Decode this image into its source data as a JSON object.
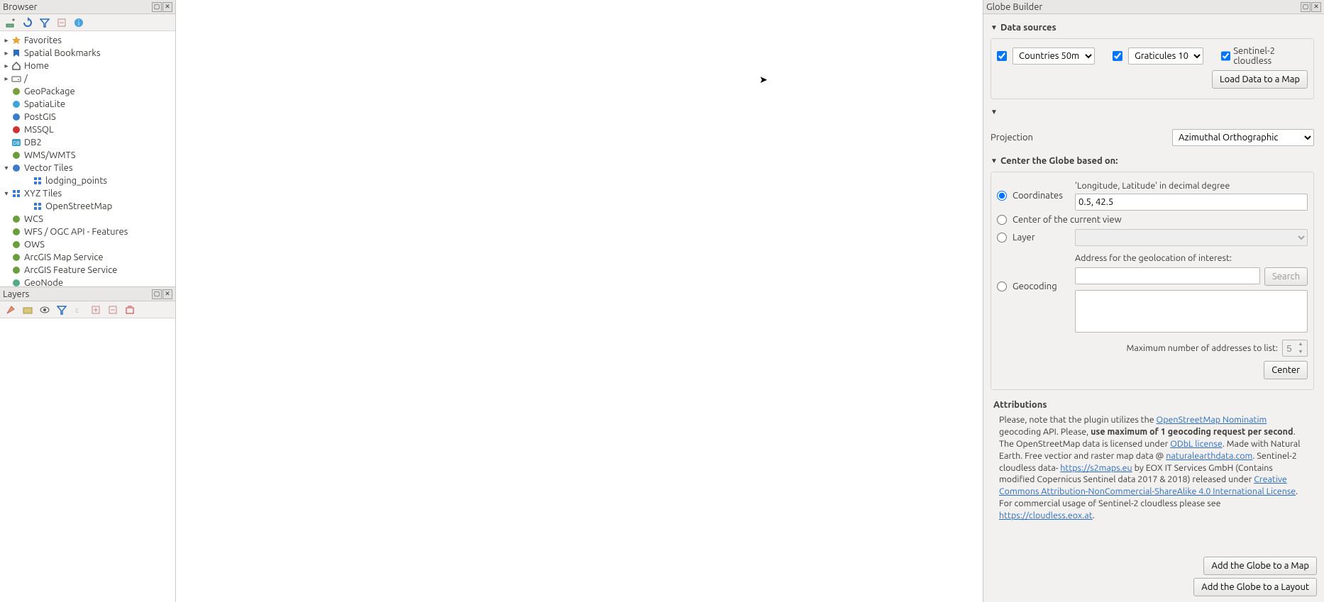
{
  "browser": {
    "title": "Browser",
    "items": [
      {
        "label": "Favorites",
        "caret": "▸",
        "indent": 0,
        "icon": "star"
      },
      {
        "label": "Spatial Bookmarks",
        "caret": "▸",
        "indent": 0,
        "icon": "bookmark"
      },
      {
        "label": "Home",
        "caret": "▸",
        "indent": 0,
        "icon": "home"
      },
      {
        "label": "/",
        "caret": "▸",
        "indent": 0,
        "icon": "drive"
      },
      {
        "label": "GeoPackage",
        "caret": "",
        "indent": 0,
        "icon": "gpkg"
      },
      {
        "label": "SpatiaLite",
        "caret": "",
        "indent": 0,
        "icon": "spatialite"
      },
      {
        "label": "PostGIS",
        "caret": "",
        "indent": 0,
        "icon": "postgis"
      },
      {
        "label": "MSSQL",
        "caret": "",
        "indent": 0,
        "icon": "mssql"
      },
      {
        "label": "DB2",
        "caret": "",
        "indent": 0,
        "icon": "db2"
      },
      {
        "label": "WMS/WMTS",
        "caret": "",
        "indent": 0,
        "icon": "wms"
      },
      {
        "label": "Vector Tiles",
        "caret": "▾",
        "indent": 0,
        "icon": "vectortiles"
      },
      {
        "label": "lodging_points",
        "caret": "",
        "indent": 1,
        "icon": "grid"
      },
      {
        "label": "XYZ Tiles",
        "caret": "▾",
        "indent": 0,
        "icon": "grid"
      },
      {
        "label": "OpenStreetMap",
        "caret": "",
        "indent": 1,
        "icon": "grid"
      },
      {
        "label": "WCS",
        "caret": "",
        "indent": 0,
        "icon": "wcs"
      },
      {
        "label": "WFS / OGC API - Features",
        "caret": "",
        "indent": 0,
        "icon": "wfs"
      },
      {
        "label": "OWS",
        "caret": "",
        "indent": 0,
        "icon": "ows"
      },
      {
        "label": "ArcGIS Map Service",
        "caret": "",
        "indent": 0,
        "icon": "arcgis"
      },
      {
        "label": "ArcGIS Feature Service",
        "caret": "",
        "indent": 0,
        "icon": "arcgis"
      },
      {
        "label": "GeoNode",
        "caret": "",
        "indent": 0,
        "icon": "geonode"
      }
    ]
  },
  "layers": {
    "title": "Layers"
  },
  "globe": {
    "title": "Globe Builder",
    "datasources_hdr": "Data sources",
    "countries": "Countries 50m",
    "graticules": "Graticules 10",
    "sentinel": "Sentinel-2 cloudless",
    "load_btn": "Load Data to a Map",
    "projection_lbl": "Projection",
    "projection_val": "Azimuthal Orthographic",
    "center_hdr": "Center the Globe based on:",
    "coords_lbl": "Coordinates",
    "coords_hint": "'Longitude, Latitude' in decimal degree",
    "coords_val": "0.5, 42.5",
    "centerview_lbl": "Center of the current view",
    "layer_lbl": "Layer",
    "geocoding_lbl": "Geocoding",
    "address_lbl": "Address for the geolocation of interest:",
    "search_btn": "Search",
    "max_lbl": "Maximum number of addresses to list:",
    "max_val": "5",
    "center_btn": "Center",
    "attrib_hdr": "Attributions",
    "attrib": {
      "t1": "Please, note that the plugin utilizes the ",
      "l1": "OpenStreetMap Nominatim",
      "t2": " geocoding API. Please, ",
      "b1": "use maximum of 1 geocoding request per second",
      "t3": ". The OpenStreetMap data is licensed under ",
      "l2": "ODbL license",
      "t4": ". Made with Natural Earth. Free vectior and raster map data @ ",
      "l3": "naturalearthdata.com",
      "t5": ". Sentinel-2 cloudless data- ",
      "l4": "https://s2maps.eu",
      "t6": " by EOX IT Services GmbH (Contains modified Copernicus Sentinel data 2017 & 2018) released under ",
      "l5": "Creative Commons Attribution-NonCommercial-ShareAlike 4.0 International License",
      "t7": ". For commercial usage of Sentinel-2 cloudless please see ",
      "l6": "https://cloudless.eox.at",
      "t8": "."
    },
    "add_map_btn": "Add the Globe to a Map",
    "add_layout_btn": "Add the Globe to a Layout"
  }
}
